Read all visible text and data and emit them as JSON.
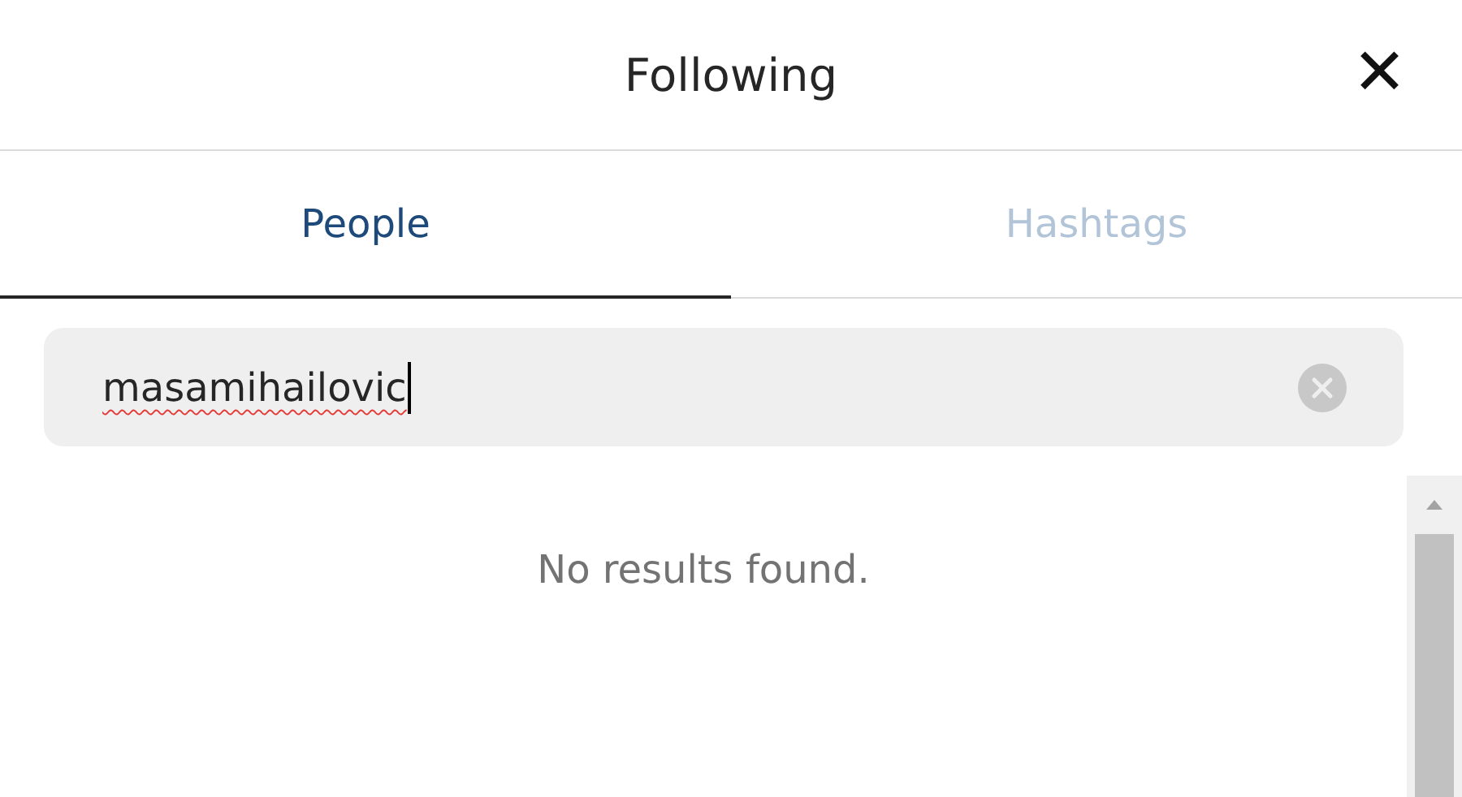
{
  "header": {
    "title": "Following",
    "close": "✕"
  },
  "tabs": [
    {
      "label": "People",
      "selected": true
    },
    {
      "label": "Hashtags",
      "selected": false
    }
  ],
  "search": {
    "value": "masamihailovic"
  },
  "message": "No results found."
}
